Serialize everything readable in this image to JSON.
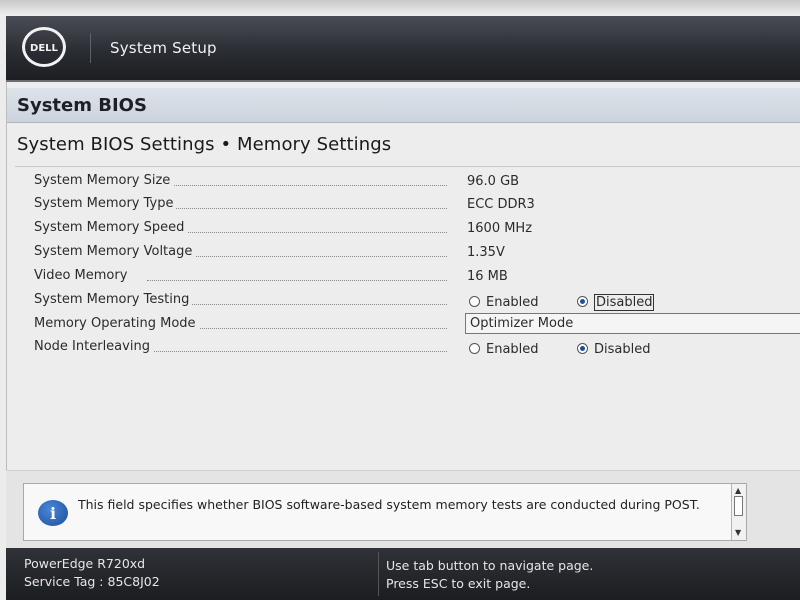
{
  "header": {
    "logo_text": "DELL",
    "title": "System Setup"
  },
  "page": {
    "section_title": "System BIOS",
    "breadcrumb": "System BIOS Settings • Memory Settings"
  },
  "settings": [
    {
      "label": "System Memory Size",
      "value": "96.0 GB"
    },
    {
      "label": "System Memory Type",
      "value": "ECC DDR3"
    },
    {
      "label": "System Memory Speed",
      "value": "1600 MHz"
    },
    {
      "label": "System Memory Voltage",
      "value": "1.35V"
    },
    {
      "label": "Video Memory",
      "value": "16 MB"
    },
    {
      "label": "System Memory Testing",
      "options": [
        "Enabled",
        "Disabled"
      ],
      "selected": "Disabled",
      "focused": true
    },
    {
      "label": "Memory Operating Mode",
      "value": "Optimizer Mode"
    },
    {
      "label": "Node Interleaving",
      "options": [
        "Enabled",
        "Disabled"
      ],
      "selected": "Disabled",
      "focused": false
    }
  ],
  "help": {
    "icon": "info-icon",
    "text": "This field specifies whether BIOS software-based system memory tests are conducted during POST."
  },
  "footer": {
    "model": "PowerEdge R720xd",
    "service_tag": "Service Tag : 85C8J02",
    "tip_tab": "Use tab button to navigate page.",
    "tip_esc": "Press ESC to exit page."
  },
  "colors": {
    "header_bg": "#2a2d33",
    "panel_bg": "#ededed",
    "title_bar": "#cbd3dc",
    "radio_selected": "#1f4f9a",
    "info_icon": "#1b4f9c"
  }
}
